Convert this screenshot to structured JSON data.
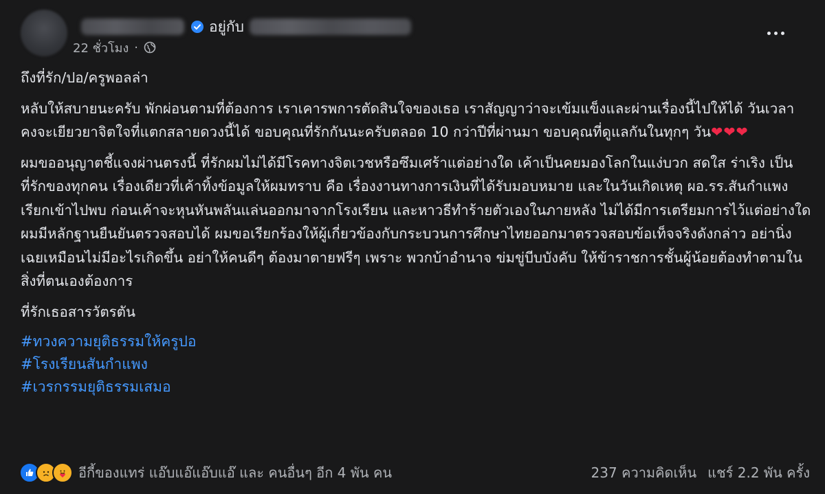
{
  "header": {
    "with_text": "อยู่กับ",
    "time": "22 ชั่วโมง",
    "separator": "·"
  },
  "body": {
    "greeting": "ถึงที่รัก/ปอ/ครูพอลล่า",
    "para1": "หลับให้สบายนะครับ พักผ่อนตามที่ต้องการ เราเคารพการตัดสินใจของเธอ เราสัญญาว่าจะเข้มแข็งและผ่านเรื่องนี้ไปให้ได้ วันเวลาคงจะเยียวยาจิตใจที่แตกสลายดวงนี้ได้ ขอบคุณที่รักกันนะครับตลอด 10 กว่าปีที่ผ่านมา ขอบคุณที่ดูแลกันในทุกๆ วัน",
    "hearts": "❤❤❤",
    "para2": "ผมขออนุญาตชี้แจงผ่านตรงนี้ ที่รักผมไม่ได้มีโรคทางจิตเวชหรือซึมเศร้าแต่อย่างใด เค้าเป็นคยมองโลกในแง่บวก สดใส ร่าเริง เป็นที่รักของทุกคน เรื่องเดียวที่เค้าทิ้งข้อมูลให้ผมทราบ คือ เรื่องงานทางการเงินที่ได้รับมอบหมาย และในวันเกิดเหตุ ผอ.รร.สันกำแพง เรียกเข้าไปพบ ก่อนเค้าจะหุนหันพลันแล่นออกมาจากโรงเรียน และหาวธีทำร้ายตัวเองในภายหลัง ไม่ได้มีการเตรียมการไว้แต่อย่างใด ผมมีหลักฐานยืนยันตรวจสอบได้ ผมขอเรียกร้องให้ผู้เกี่ยวข้องกับกระบวนการศึกษาไทยออกมาตรวจสอบข้อเท็จจริงดังกล่าว อย่านิ่งเฉยเหมือนไม่มีอะไรเกิดขึ้น อย่าให้คนดีๆ ต้องมาตายฟรีๆ เพราะ พวกบ้าอำนาจ ข่มขู่บีบบังคับ ให้ข้าราชการชั้นผู้น้อยต้องทำตามในสิ่งที่ตนเองต้องการ",
    "closing": "ที่รักเธอสารวัตรตัน",
    "hashtags": [
      "#ทวงความยุติธรรมให้ครูปอ",
      "#โรงเรียนสันกำแพง",
      "#เวรกรรมยุติธรรมเสมอ"
    ]
  },
  "footer": {
    "reactions_text": "อีกี้ของแทร่ แอ๊บแอ๊แอ๊บแอ๊ และ คนอื่นๆ อีก 4 พัน คน",
    "comments": "237 ความคิดเห็น",
    "shares": "แชร์ 2.2 พัน ครั้ง"
  },
  "icons": {
    "like": "like-icon",
    "sad": "sad-icon",
    "care": "care-icon",
    "globe": "globe-icon",
    "verified": "verified-badge-icon",
    "more": "more-options-icon"
  },
  "colors": {
    "background": "#19191a",
    "text": "#e4e6eb",
    "secondary_text": "#b0b3b8",
    "hashtag": "#4599ff",
    "verified": "#2d88ff",
    "like": "#1877f2",
    "heart": "#f02849"
  }
}
